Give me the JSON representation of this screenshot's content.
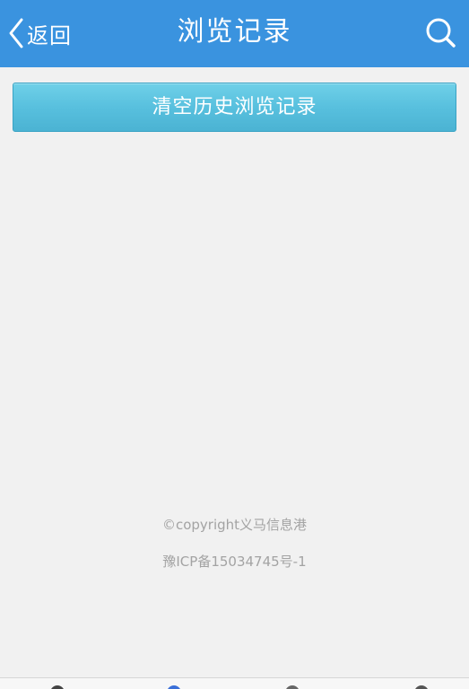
{
  "header": {
    "back_label": "返回",
    "title": "浏览记录",
    "accent_color": "#3a93df"
  },
  "actions": {
    "clear_history_label": "清空历史浏览记录",
    "button_color": "#58c0de"
  },
  "footer": {
    "copyright": "©copyright义马信息港",
    "icp": "豫ICP备15034745号-1"
  },
  "icons": {
    "back": "chevron-left-icon",
    "search": "search-icon"
  },
  "bottom_tabs": [
    {
      "icon": "tab-icon-1"
    },
    {
      "icon": "tab-icon-2"
    },
    {
      "icon": "tab-icon-3"
    },
    {
      "icon": "tab-icon-4"
    }
  ]
}
